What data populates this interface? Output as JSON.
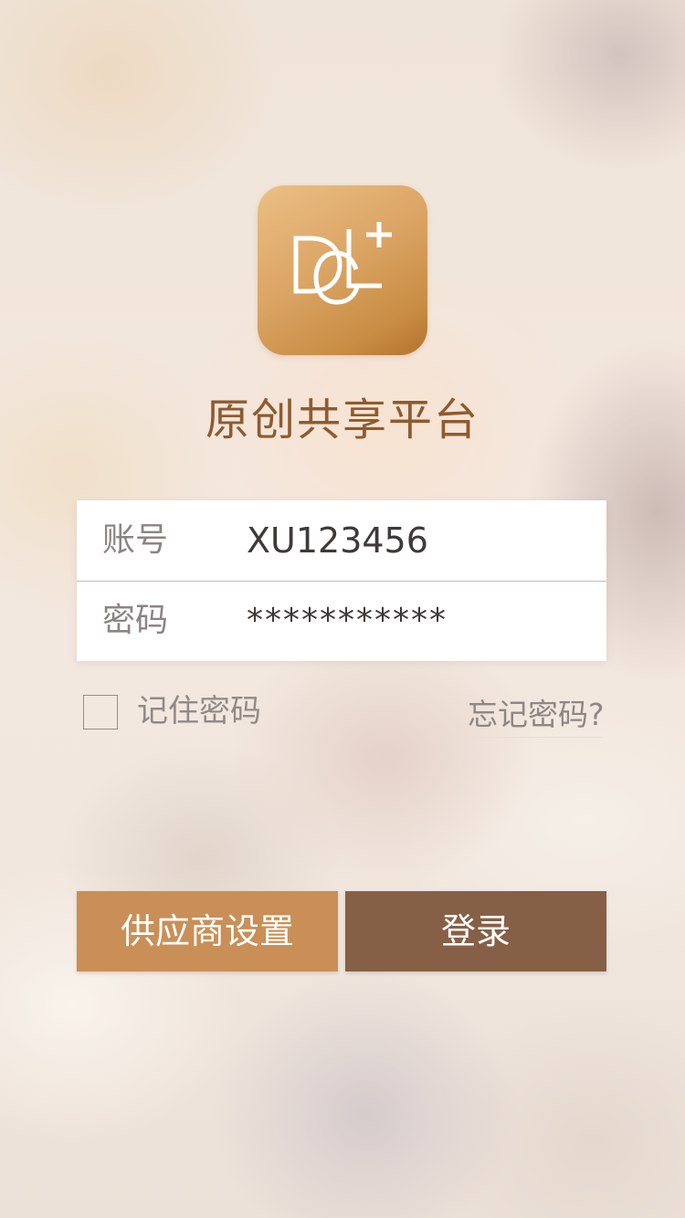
{
  "app": {
    "logo_text": "DL+C",
    "title": "原创共享平台"
  },
  "login_form": {
    "account_label": "账号",
    "account_value": "XU123456",
    "password_label": "密码",
    "password_value": "***********"
  },
  "options": {
    "remember_label": "记住密码",
    "remember_checked": false,
    "forgot_label": "忘记密码?"
  },
  "actions": {
    "supplier_label": "供应商设置",
    "login_label": "登录"
  },
  "colors": {
    "brand_gold": "#d9a15f",
    "title_brown": "#8e5b2f",
    "supplier_button": "#c98f57",
    "login_button": "#866046"
  }
}
